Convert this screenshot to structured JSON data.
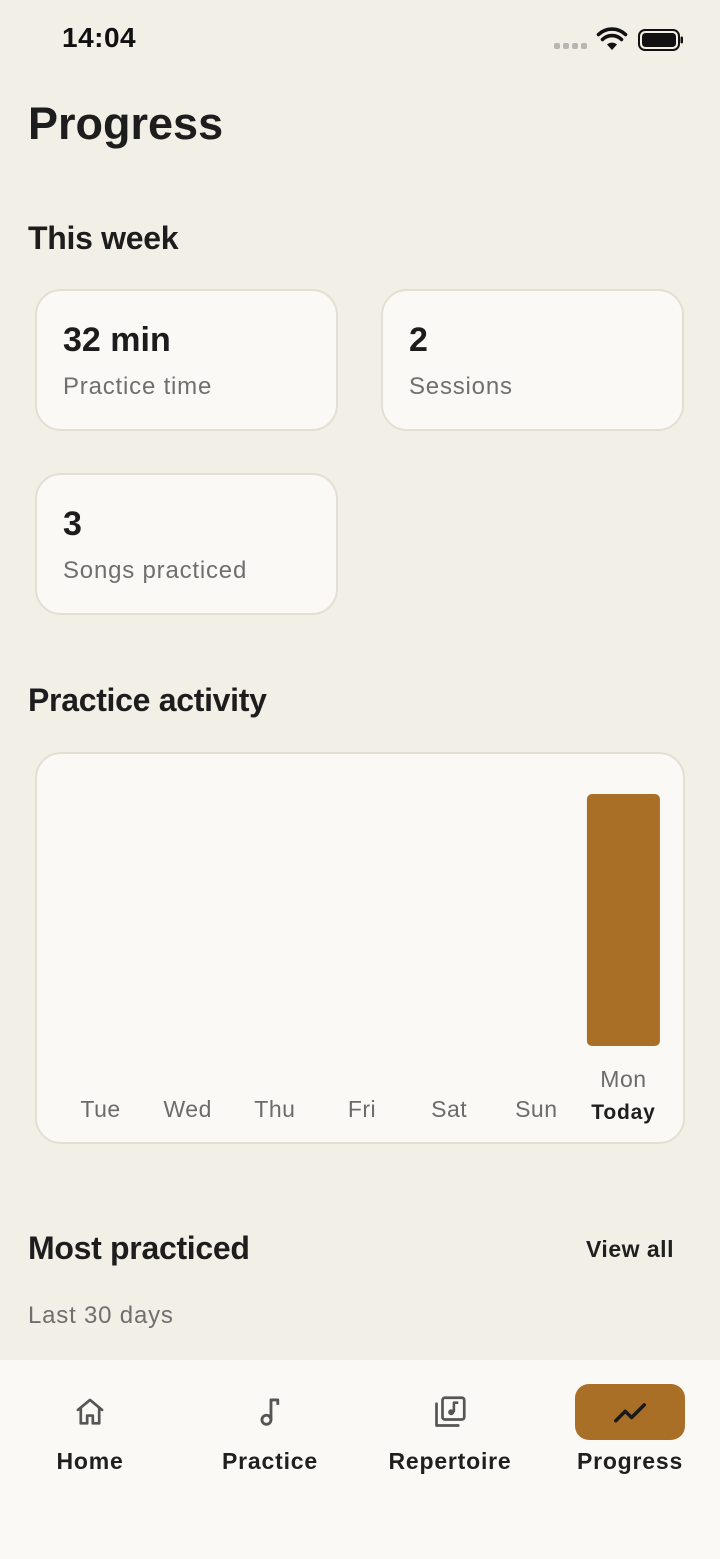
{
  "status": {
    "time": "14:04"
  },
  "page": {
    "title": "Progress"
  },
  "this_week": {
    "title": "This week",
    "stats": [
      {
        "value": "32 min",
        "label": "Practice time"
      },
      {
        "value": "2",
        "label": "Sessions"
      },
      {
        "value": "3",
        "label": "Songs practiced"
      }
    ]
  },
  "activity": {
    "title": "Practice activity"
  },
  "chart_data": {
    "type": "bar",
    "categories": [
      "Tue",
      "Wed",
      "Thu",
      "Fri",
      "Sat",
      "Sun",
      "Mon"
    ],
    "values": [
      0,
      0,
      0,
      0,
      0,
      0,
      32
    ],
    "highlight_category": "Mon",
    "highlight_sublabel": "Today",
    "bar_color": "#a96f27",
    "grid": false,
    "legend": "none"
  },
  "most_practiced": {
    "title": "Most practiced",
    "view_all_label": "View all",
    "subtitle": "Last 30 days"
  },
  "nav": {
    "active": "Progress",
    "accent": "#a96f27",
    "items": [
      {
        "label": "Home",
        "icon": "home-icon"
      },
      {
        "label": "Practice",
        "icon": "music-note-icon"
      },
      {
        "label": "Repertoire",
        "icon": "music-library-icon"
      },
      {
        "label": "Progress",
        "icon": "trending-up-icon"
      }
    ]
  }
}
